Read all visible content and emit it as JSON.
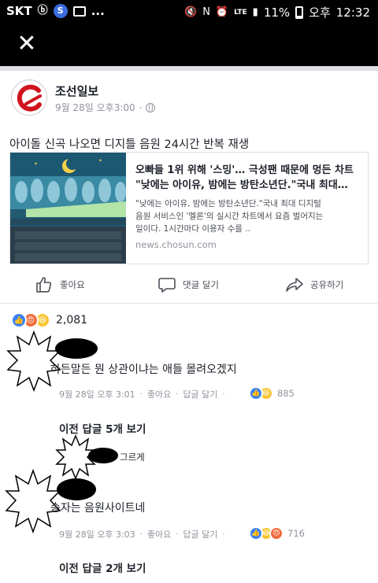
{
  "status_bar": {
    "carrier": "SKT",
    "s_icon": "S",
    "notify_more": "...",
    "network": "LTE",
    "battery": "11%",
    "time_period": "오후",
    "time": "12:32"
  },
  "header": {
    "close_icon_char": "✕"
  },
  "post": {
    "page_name": "조선일보",
    "timestamp": "9월 28일 오후3:00",
    "meta_dot": "·",
    "text": "아이돌 신곡 나오면 디지틀 음원 24시간 반복 재생",
    "link": {
      "title_line1": "오빠들 1위 위해 '스밍'… 극성팬 때문에 멍든 차트",
      "title_line2": "\"낮에는 아이유, 밤에는 방탄소년단.\"국내 최대…",
      "desc_line1": "\"낮에는 아이유, 밤에는 방탄소년단.\"국내 최대 디지털",
      "desc_line2": "음원 서비스인 '멜론'의 실시간 차트에서 요즘 벌어지는",
      "desc_line3": "일이다. 1시간마다 이용자 수를 ..",
      "domain": "news.chosun.com"
    },
    "actions": {
      "like": "좋아요",
      "comment": "댓글 달기",
      "share": "공유하기"
    },
    "reaction_count": "2,081"
  },
  "comments": [
    {
      "text": "하든말든 뭔 상관이냐는 애들 몰려오겠지",
      "time": "9월 28일 오후 3:01",
      "like": "좋아요",
      "reply": "답글 달기",
      "reaction_count": "885",
      "see_more": "이전 답글 5개 보기",
      "reply_preview": "그르게"
    },
    {
      "text": "승자는 음원사이트네",
      "time": "9월 28일 오후 3:03",
      "like": "좋아요",
      "reply": "답글 달기",
      "reaction_count": "716",
      "see_more": "이전 답글 2개 보기"
    }
  ],
  "meta_separator": "·",
  "colors": {
    "like_blue": "#3b82f6",
    "angry_orange": "#f06b3a",
    "haha_yellow": "#f7c531",
    "brand_red": "#d0141e",
    "meta_gray": "#90949c"
  }
}
